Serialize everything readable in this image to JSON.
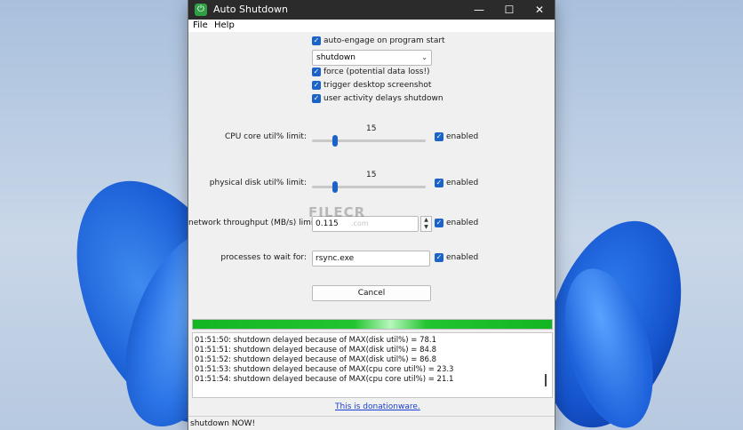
{
  "window": {
    "title": "Auto Shutdown",
    "app_icon": "power-icon"
  },
  "menu": {
    "file": "File",
    "help": "Help"
  },
  "options": {
    "auto_engage": {
      "label": "auto-engage on program start",
      "checked": true
    },
    "action_select": {
      "value": "shutdown"
    },
    "force": {
      "label": "force (potential data loss!)",
      "checked": true
    },
    "screenshot": {
      "label": "trigger desktop screenshot",
      "checked": true
    },
    "user_activity": {
      "label": "user activity delays shutdown",
      "checked": true
    }
  },
  "cpu": {
    "label": "CPU core util% limit:",
    "value": "15",
    "enabled_label": "enabled",
    "enabled": true
  },
  "disk": {
    "label": "physical disk util% limit:",
    "value": "15",
    "enabled_label": "enabled",
    "enabled": true
  },
  "network": {
    "label": "network throughput (MB/s) limit:",
    "value": "0.115",
    "enabled_label": "enabled",
    "enabled": true
  },
  "processes": {
    "label": "processes to wait for:",
    "value": "rsync.exe",
    "enabled_label": "enabled",
    "enabled": true
  },
  "cancel_label": "Cancel",
  "progress": {
    "fraction": 1.0
  },
  "log": [
    "01:51:50: shutdown delayed because of MAX(disk util%) = 78.1",
    "01:51:51: shutdown delayed because of MAX(disk util%) = 84.8",
    "01:51:52: shutdown delayed because of MAX(disk util%) = 86.8",
    "01:51:53: shutdown delayed because of MAX(cpu core util%) = 23.3",
    "01:51:54: shutdown delayed because of MAX(cpu core util%) = 21.1"
  ],
  "donation_link": "This is donationware.",
  "status": "shutdown NOW!",
  "watermark": {
    "main": "FILECR",
    "sub": ".com"
  },
  "colors": {
    "accent": "#1b63c9",
    "progress": "#22c52f",
    "link": "#1a3fd1",
    "titlebar": "#2b2b2b"
  }
}
